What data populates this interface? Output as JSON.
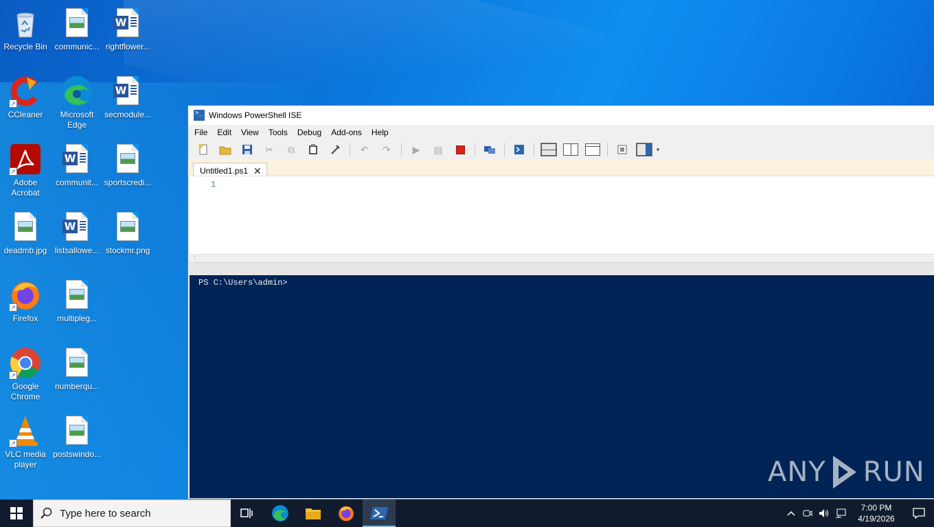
{
  "desktop": {
    "icons": [
      {
        "label": "Recycle Bin",
        "icon": "recycle-bin-icon"
      },
      {
        "label": "communic...",
        "icon": "image-file-icon"
      },
      {
        "label": "rightflower...",
        "icon": "word-document-icon"
      },
      {
        "label": "CCleaner",
        "icon": "ccleaner-icon"
      },
      {
        "label": "Microsoft Edge",
        "icon": "edge-icon"
      },
      {
        "label": "secmodule...",
        "icon": "word-document-icon"
      },
      {
        "label": "Adobe Acrobat",
        "icon": "adobe-acrobat-icon"
      },
      {
        "label": "communit...",
        "icon": "word-document-icon"
      },
      {
        "label": "sportscredi...",
        "icon": "image-file-icon"
      },
      {
        "label": "deadmb.jpg",
        "icon": "image-file-icon"
      },
      {
        "label": "listsallowe...",
        "icon": "word-document-icon"
      },
      {
        "label": "stockmr.png",
        "icon": "image-file-icon"
      },
      {
        "label": "Firefox",
        "icon": "firefox-icon"
      },
      {
        "label": "multipleg...",
        "icon": "image-file-icon"
      },
      {
        "label": "Google Chrome",
        "icon": "chrome-icon"
      },
      {
        "label": "numberqu...",
        "icon": "image-file-icon"
      },
      {
        "label": "VLC media player",
        "icon": "vlc-icon"
      },
      {
        "label": "postswindo...",
        "icon": "image-file-icon"
      }
    ]
  },
  "ise": {
    "title": "Windows PowerShell ISE",
    "menu": [
      "File",
      "Edit",
      "View",
      "Tools",
      "Debug",
      "Add-ons",
      "Help"
    ],
    "tab": {
      "label": "Untitled1.ps1",
      "close": "✕"
    },
    "editor": {
      "line_number": "1"
    },
    "console": {
      "prompt": "PS C:\\Users\\admin>"
    },
    "colors": {
      "console_bg": "#012456",
      "tab_strip_bg": "#fdf2dd",
      "line_number": "#2b91af"
    }
  },
  "watermark": {
    "left": "ANY",
    "right": "RUN"
  },
  "taskbar": {
    "search_placeholder": "Type here to search",
    "clock": {
      "time": "7:00 PM",
      "date": "4/19/2026"
    }
  }
}
